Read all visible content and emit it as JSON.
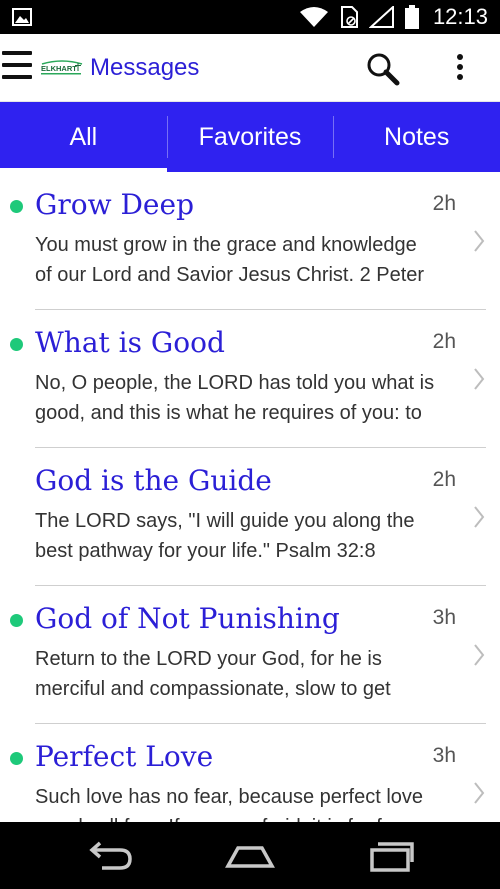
{
  "status_bar": {
    "time": "12:13"
  },
  "app_bar": {
    "title": "Messages",
    "logo_text": "ELKHART"
  },
  "tabs": [
    {
      "label": "All",
      "active": true
    },
    {
      "label": "Favorites",
      "active": false
    },
    {
      "label": "Notes",
      "active": false
    }
  ],
  "messages": [
    {
      "title": "Grow Deep",
      "time": "2h",
      "unread": true,
      "line1": "You must grow in the grace and knowledge",
      "line2": "of our Lord and Savior Jesus Christ. 2 Peter"
    },
    {
      "title": "What is Good",
      "time": "2h",
      "unread": true,
      "line1": "No, O people, the LORD has told you what is",
      "line2": "good, and this is what he requires of you: to"
    },
    {
      "title": "God is the Guide",
      "time": "2h",
      "unread": false,
      "line1": "The LORD says, \"I will guide you along the",
      "line2": "best pathway for your life.\" Psalm 32:8"
    },
    {
      "title": "God of Not Punishing",
      "time": "3h",
      "unread": true,
      "line1": "Return to the LORD your God, for he is",
      "line2": "merciful and compassionate, slow to get"
    },
    {
      "title": "Perfect Love",
      "time": "3h",
      "unread": true,
      "line1": "Such love has no fear, because perfect love",
      "line2": "expels all fear. If we are afraid, it is for fear"
    }
  ],
  "colors": {
    "accent": "#2f22f0",
    "title_text": "#2b1fd6",
    "unread_dot": "#1ec97a"
  }
}
